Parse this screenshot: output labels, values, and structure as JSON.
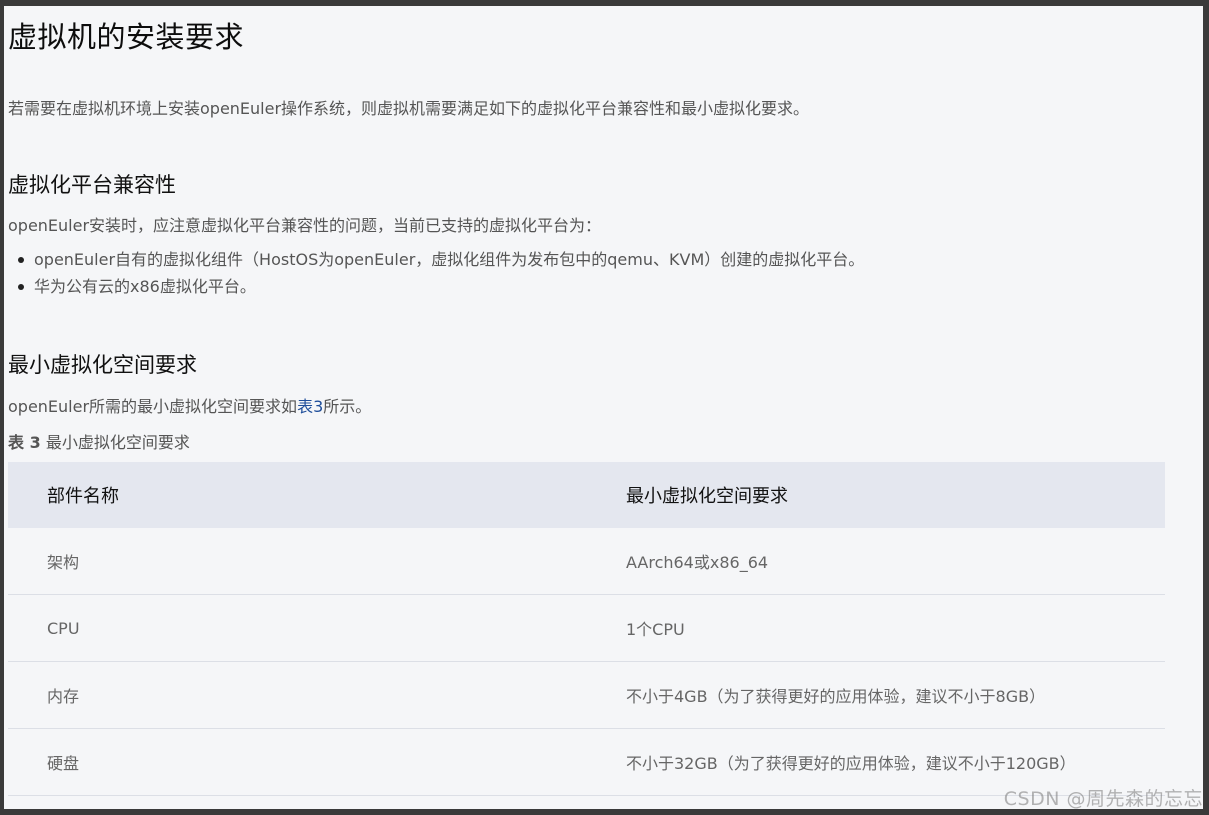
{
  "title": "虚拟机的安装要求",
  "intro": "若需要在虚拟机环境上安装openEuler操作系统，则虚拟机需要满足如下的虚拟化平台兼容性和最小虚拟化要求。",
  "section1": {
    "heading": "虚拟化平台兼容性",
    "paragraph": "openEuler安装时，应注意虚拟化平台兼容性的问题，当前已支持的虚拟化平台为：",
    "bullets": [
      "openEuler自有的虚拟化组件（HostOS为openEuler，虚拟化组件为发布包中的qemu、KVM）创建的虚拟化平台。",
      "华为公有云的x86虚拟化平台。"
    ]
  },
  "section2": {
    "heading": "最小虚拟化空间要求",
    "paragraph_before": "openEuler所需的最小虚拟化空间要求如",
    "paragraph_link": "表3",
    "paragraph_after": "所示。",
    "caption_label": "表 3",
    "caption_text": "最小虚拟化空间要求"
  },
  "table": {
    "headers": [
      "部件名称",
      "最小虚拟化空间要求"
    ],
    "rows": [
      [
        "架构",
        "AArch64或x86_64"
      ],
      [
        "CPU",
        "1个CPU"
      ],
      [
        "内存",
        "不小于4GB（为了获得更好的应用体验，建议不小于8GB）"
      ],
      [
        "硬盘",
        "不小于32GB（为了获得更好的应用体验，建议不小于120GB）"
      ]
    ]
  },
  "watermark": "CSDN @周先森的忘忘"
}
